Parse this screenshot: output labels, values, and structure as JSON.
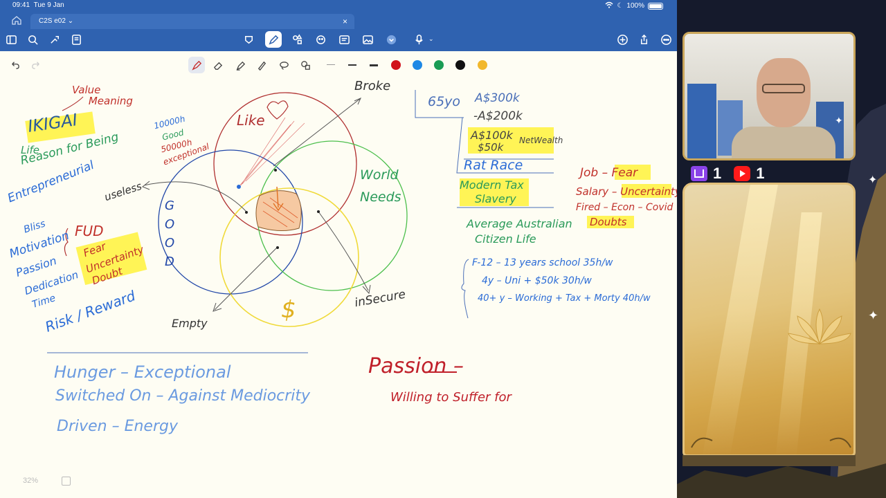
{
  "status": {
    "time": "09:41",
    "date": "Tue 9 Jan",
    "battery": "100%"
  },
  "tab": {
    "title": "C2S e02",
    "caret": "⌄",
    "close": "×"
  },
  "toolbar": {
    "icons": [
      "sidebar-icon",
      "search-icon",
      "bookmark-icon",
      "page-icon",
      "lasso-icon",
      "pen-icon",
      "shapes-icon",
      "sticker-icon",
      "text-icon",
      "image-icon",
      "more-tools-icon",
      "mic-icon",
      "add-icon",
      "share-icon",
      "more-icon"
    ]
  },
  "pen_toolbar": {
    "colors": [
      "#d1121a",
      "#1e88e5",
      "#1a9c55",
      "#111111",
      "#f2b82c"
    ]
  },
  "canvas": {
    "ikigai": {
      "title": "IKIGAI",
      "value": "Value",
      "meaning": "Meaning",
      "life": "Life",
      "reason": "Reason for Being"
    },
    "left_list": [
      "Entrepreneurial",
      "Bliss",
      "Motivation",
      "Passion",
      "Dedication",
      "Time"
    ],
    "fud": {
      "title": "FUD",
      "items": [
        "Fear",
        "Uncertainty",
        "Doubt"
      ]
    },
    "risk": "Risk / Reward",
    "useless": "useless",
    "good_notes": [
      "10000h",
      "Good",
      "50000h",
      "exceptional"
    ],
    "venn": {
      "like": "Like",
      "world": "World",
      "needs": "Needs",
      "good": "G O O D",
      "money": "$",
      "broke": "Broke",
      "insecure": "inSecure",
      "empty": "Empty"
    },
    "right_block": {
      "age": "65yo",
      "amounts": [
        "A$300k",
        "-A$200k",
        "A$100k",
        "$50k",
        "NetWealth"
      ],
      "rat_race": "Rat Race",
      "modern_tax": "Modern Tax",
      "slavery": "Slavery",
      "avg": "Average Australian",
      "citizen": "Citizen Life"
    },
    "job_block": [
      "Job – Fear",
      "Salary – Uncertainty",
      "Fired – Econ – Covid",
      "Doubts"
    ],
    "timeline": [
      "F-12 – 13 years school  35h/w",
      "4y – Uni + $50k  30h/w",
      "40+ y – Working + Tax + Morty 40h/w"
    ],
    "hunger": [
      "Hunger – Exceptional",
      "Switched On – Against Mediocrity",
      "Driven – Energy"
    ],
    "passion": {
      "title": "Passion –",
      "sub": "Willing to Suffer for"
    }
  },
  "zoom": "32%",
  "overlay": {
    "twitch_count": "1",
    "youtube_count": "1"
  }
}
